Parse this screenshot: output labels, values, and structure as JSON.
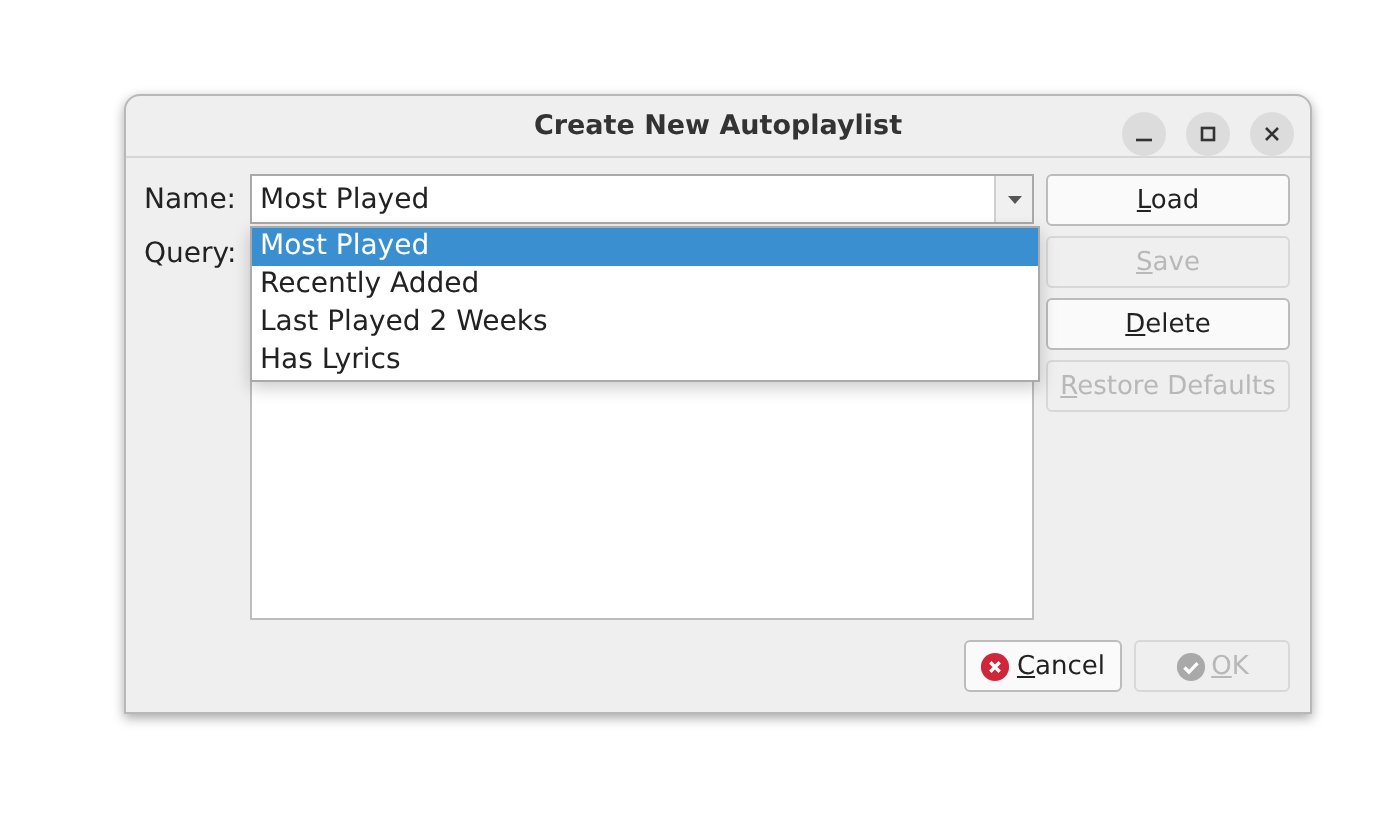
{
  "window": {
    "title": "Create New Autoplaylist",
    "controls": [
      {
        "kind": "minimize"
      },
      {
        "kind": "maximize"
      },
      {
        "kind": "close"
      }
    ]
  },
  "name_field": {
    "label": "Name:",
    "value": "Most Played",
    "expanded": true,
    "options": [
      {
        "label": "Most Played",
        "selected": true
      },
      {
        "label": "Recently Added",
        "selected": false
      },
      {
        "label": "Last Played 2 Weeks",
        "selected": false
      },
      {
        "label": "Has Lyrics",
        "selected": false
      }
    ]
  },
  "query_field": {
    "label": "Query:"
  },
  "side_buttons": [
    {
      "label": "Load",
      "disabled": false,
      "mnemonic_first": true
    },
    {
      "label": "Save",
      "disabled": true,
      "mnemonic_first": true
    },
    {
      "label": "Delete",
      "disabled": false,
      "mnemonic_first": true
    },
    {
      "label": "Restore Defaults",
      "disabled": true,
      "mnemonic_first": true
    }
  ],
  "footer_buttons": [
    {
      "kind": "cancel",
      "label": "Cancel",
      "disabled": false,
      "mnemonic_first": true
    },
    {
      "kind": "ok",
      "label": "OK",
      "disabled": true,
      "mnemonic_first": true
    }
  ]
}
